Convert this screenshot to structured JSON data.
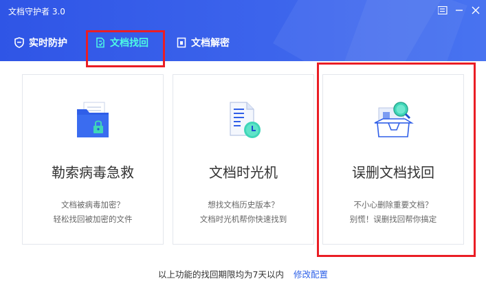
{
  "window": {
    "title": "文档守护者 3.0",
    "controls": [
      "menu-icon",
      "minimize-icon",
      "close-icon"
    ]
  },
  "tabs": [
    {
      "label": "实时防护",
      "icon": "shield-icon",
      "active": false
    },
    {
      "label": "文档找回",
      "icon": "document-recovery-icon",
      "active": true
    },
    {
      "label": "文档解密",
      "icon": "document-decrypt-icon",
      "active": false
    }
  ],
  "cards": [
    {
      "title": "勒索病毒急救",
      "desc1": "文档被病毒加密？",
      "desc2": "轻松找回被加密的文件",
      "icon": "locked-folder-icon"
    },
    {
      "title": "文档时光机",
      "desc1": "想找文档历史版本？",
      "desc2": "文档时光机帮你快速找到",
      "icon": "document-clock-icon"
    },
    {
      "title": "误删文档找回",
      "desc1": "不小心删除重要文档？",
      "desc2": "别慌！误删找回帮你搞定",
      "icon": "box-search-icon"
    }
  ],
  "footer": {
    "note": "以上功能的找回期限均为7天以内",
    "link": "修改配置"
  },
  "colors": {
    "header": "#3a60ea",
    "active_tab": "#4dfbe4",
    "highlight": "#ea1d24",
    "link": "#2f62e8",
    "accent_teal": "#3fd6b8"
  }
}
